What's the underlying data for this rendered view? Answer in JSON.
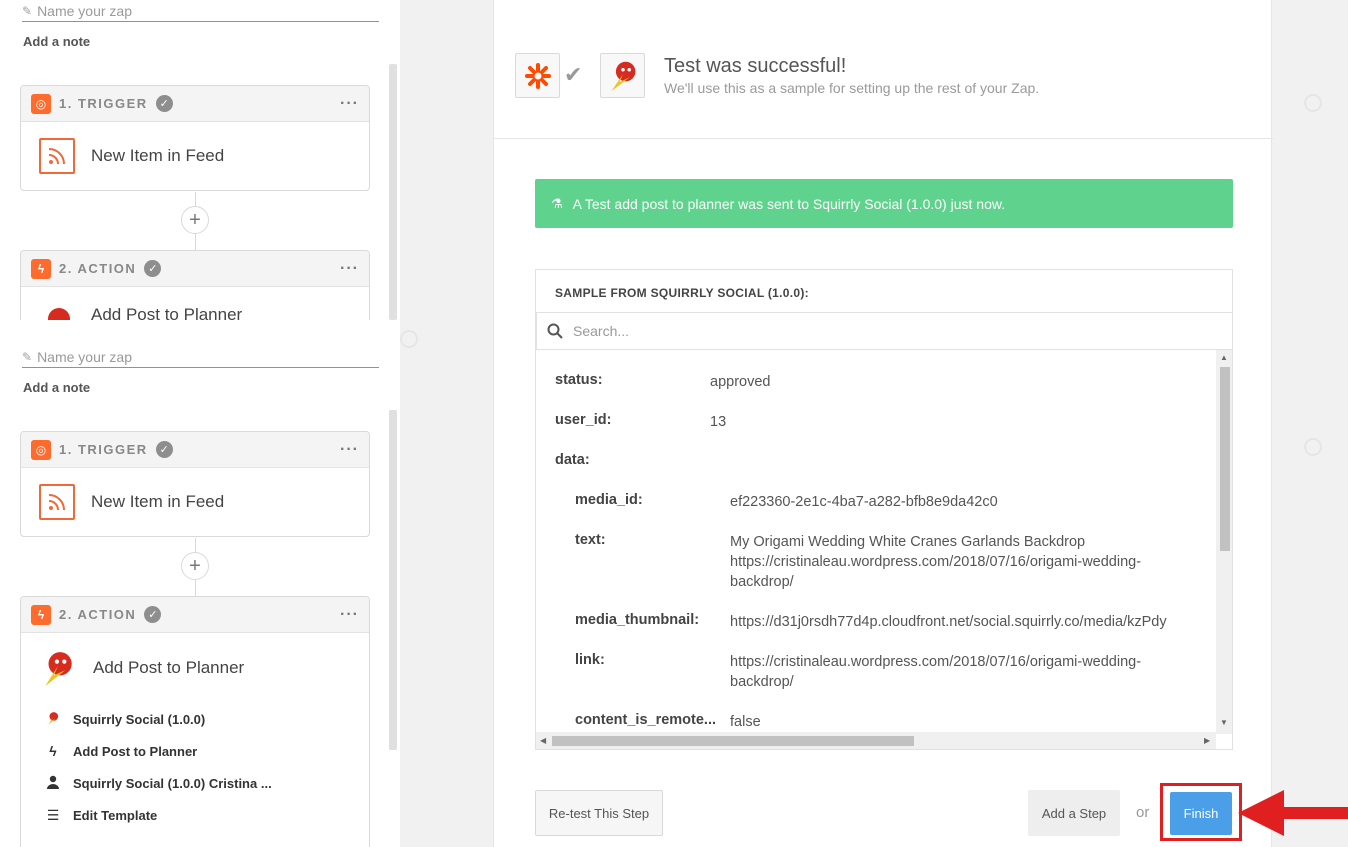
{
  "left": {
    "name_placeholder": "Name your zap",
    "add_note": "Add a note",
    "trigger": {
      "label": "1. TRIGGER",
      "title": "New Item in Feed"
    },
    "action": {
      "label": "2. ACTION",
      "title": "Add Post to Planner"
    },
    "action_items": [
      {
        "icon": "squirrly-icon",
        "label": "Squirrly Social (1.0.0)"
      },
      {
        "icon": "lightning-icon",
        "label": "Add Post to Planner"
      },
      {
        "icon": "user-icon",
        "label": "Squirrly Social (1.0.0) Cristina ..."
      },
      {
        "icon": "lines-icon",
        "label": "Edit Template"
      }
    ]
  },
  "header": {
    "title": "Test was successful!",
    "subtitle": "We'll use this as a sample for setting up the rest of your Zap."
  },
  "success_message": "A Test add post to planner was sent to Squirrly Social (1.0.0) just now.",
  "sample": {
    "title": "SAMPLE FROM SQUIRRLY SOCIAL (1.0.0):",
    "search_placeholder": "Search...",
    "fields": [
      {
        "key": "status:",
        "value": "approved"
      },
      {
        "key": "user_id:",
        "value": "13"
      },
      {
        "key": "data:",
        "value": ""
      },
      {
        "key": "media_id:",
        "value": "ef223360-2e1c-4ba7-a282-bfb8e9da42c0"
      },
      {
        "key": "text:",
        "value": "My Origami Wedding White Cranes Garlands Backdrop\nhttps://cristinaleau.wordpress.com/2018/07/16/origami-wedding-\nbackdrop/"
      },
      {
        "key": "media_thumbnail:",
        "value": "https://d31j0rsdh77d4p.cloudfront.net/social.squirrly.co/media/kzPdy"
      },
      {
        "key": "link:",
        "value": "https://cristinaleau.wordpress.com/2018/07/16/origami-wedding-\nbackdrop/"
      },
      {
        "key": "content_is_remote...",
        "value": "false"
      }
    ]
  },
  "buttons": {
    "retest": "Re-test This Step",
    "add_step": "Add a Step",
    "or": "or",
    "finish": "Finish"
  },
  "colors": {
    "accent_blue": "#4a9fe8",
    "success_green": "#5fd38d",
    "zapier_orange": "#ff6b2c",
    "highlight_red": "#e02020"
  }
}
